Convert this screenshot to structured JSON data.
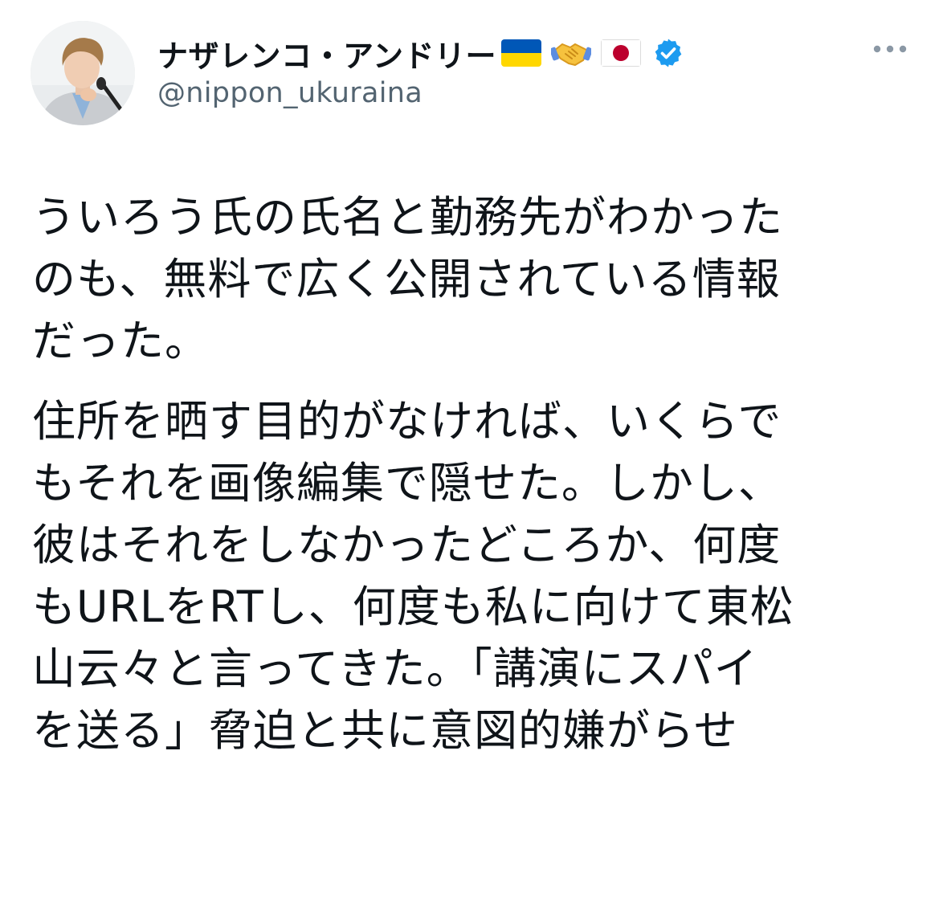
{
  "author": {
    "display_name": "ナザレンコ・アンドリー",
    "handle": "@nippon_ukuraina",
    "verified": true,
    "name_emojis": [
      "ukraine-flag",
      "handshake",
      "japan-flag"
    ]
  },
  "tweet": {
    "paragraphs": [
      "ういろう氏の氏名と勤務先がわかった\nのも、無料で広く公開されている情報\nだった。",
      "住所を晒す目的がなければ、いくらで\nもそれを画像編集で隠せた。しかし、\n彼はそれをしなかったどころか、何度\nもURLをRTし、何度も私に向けて東松\n山云々と言ってきた。「講演にスパイ\nを送る」脅迫と共に意図的嫌がらせ"
    ]
  },
  "colors": {
    "text_primary": "#0f1419",
    "text_secondary": "#536471",
    "verified_blue": "#1d9bf0",
    "ukraine_blue": "#0057b7",
    "ukraine_yellow": "#ffd700",
    "japan_red": "#bc002d"
  },
  "icons": {
    "more": "more-horizontal-icon",
    "verified": "verified-badge-icon"
  }
}
